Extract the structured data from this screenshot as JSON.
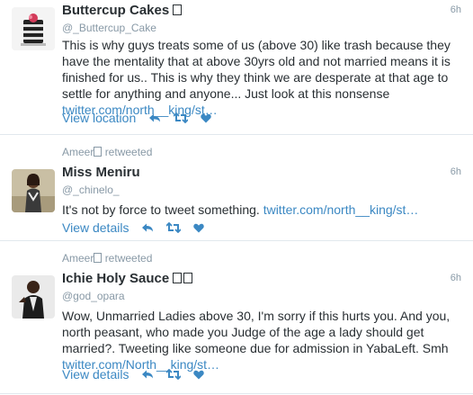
{
  "tweets": [
    {
      "name": "Buttercup Cakes",
      "handle": "@_Buttercup_Cake",
      "time": "6h",
      "text": "This is why guys treats some of us (above 30) like trash because they have the mentality that at above 30yrs old and not married means it is finished for us.. This is why they think we are desperate at that age to settle for anything and anyone... Just look at this nonsense",
      "link": "twitter.com/north__king/st…",
      "action_label": "View location"
    },
    {
      "retweeted_by": "Ameer",
      "retweet_label": "retweeted",
      "name": "Miss Meniru",
      "handle": "@_chinelo_",
      "time": "6h",
      "text": "It's not by force to tweet something.",
      "link": "twitter.com/north__king/st…",
      "action_label": "View details"
    },
    {
      "retweeted_by": "Ameer",
      "retweet_label": "retweeted",
      "name": "Ichie Holy Sauce",
      "handle": "@god_opara",
      "time": "6h",
      "text": "Wow, Unmarried Ladies above 30, I'm sorry if this hurts you. And you, north peasant, who made you Judge of the age a lady should get married?. Tweeting like someone due for admission in YabaLeft. Smh",
      "link": "twitter.com/North__king/st…",
      "action_label": "View details"
    }
  ],
  "icons": {
    "reply": "reply-icon",
    "retweet": "retweet-icon",
    "like": "heart-icon"
  },
  "colors": {
    "link": "#3b88c3",
    "meta": "#8899a6",
    "text": "#292f33",
    "divider": "#e1e8ed"
  }
}
